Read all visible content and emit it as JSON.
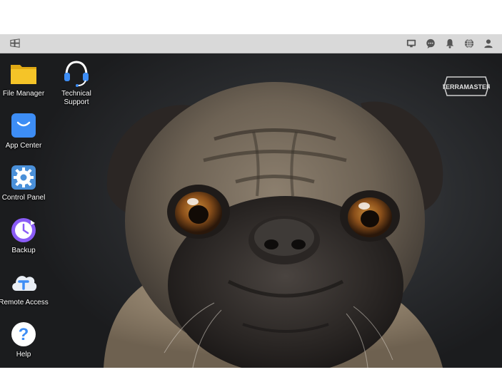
{
  "taskbar": {
    "left_icon": "windows-icon",
    "right_icons": [
      "screen-icon",
      "chat-icon",
      "bell-icon",
      "globe-icon",
      "user-icon"
    ]
  },
  "desktop": {
    "icons": [
      {
        "label": "File Manager",
        "icon": "folder-icon"
      },
      {
        "label": "Technical\nSupport",
        "icon": "headset-icon"
      },
      {
        "label": "App Center",
        "icon": "shopping-bag-icon"
      },
      {
        "label": "Control Panel",
        "icon": "gear-icon"
      },
      {
        "label": "Backup",
        "icon": "clock-icon"
      },
      {
        "label": "Remote Access",
        "icon": "cloud-icon"
      },
      {
        "label": "Help",
        "icon": "question-icon"
      }
    ],
    "brand": "TERRAMASTER"
  },
  "colors": {
    "taskbar": "#d9d9d9",
    "folder": "#f5c428",
    "accent_blue": "#3d8df5"
  }
}
